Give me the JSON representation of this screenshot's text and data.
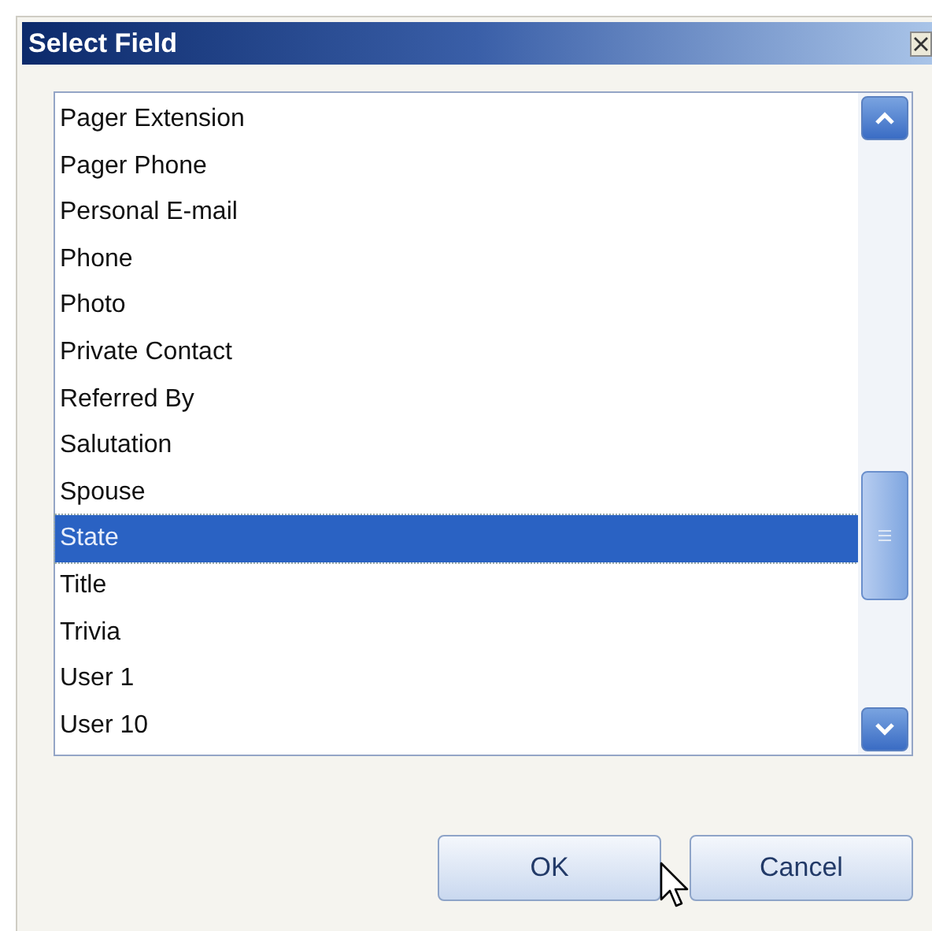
{
  "window": {
    "title": "Select Field"
  },
  "fields": [
    {
      "label": "Pager Extension",
      "selected": false
    },
    {
      "label": "Pager Phone",
      "selected": false
    },
    {
      "label": "Personal E-mail",
      "selected": false
    },
    {
      "label": "Phone",
      "selected": false
    },
    {
      "label": "Photo",
      "selected": false
    },
    {
      "label": "Private Contact",
      "selected": false
    },
    {
      "label": "Referred By",
      "selected": false
    },
    {
      "label": "Salutation",
      "selected": false
    },
    {
      "label": "Spouse",
      "selected": false
    },
    {
      "label": "State",
      "selected": true
    },
    {
      "label": "Title",
      "selected": false
    },
    {
      "label": "Trivia",
      "selected": false
    },
    {
      "label": "User 1",
      "selected": false
    },
    {
      "label": "User 10",
      "selected": false
    }
  ],
  "buttons": [
    {
      "label": "OK"
    },
    {
      "label": "Cancel"
    }
  ]
}
